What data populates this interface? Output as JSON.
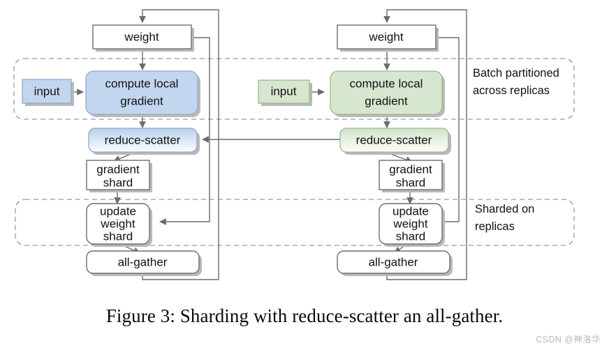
{
  "figure": {
    "caption": "Figure 3:  Sharding with reduce-scatter an all-gather.",
    "watermark": "CSDN @神洛华"
  },
  "colors": {
    "blue_fill": "#c3d6ef",
    "blue_stroke": "#8ea9c9",
    "blue_gradient_top": "#bcd2ec",
    "blue_gradient_bottom": "#fbfdff",
    "green_fill": "#d7e6cf",
    "green_stroke": "#9cb893",
    "green_gradient_top": "#d4e4cc",
    "green_gradient_bottom": "#fbfdfa",
    "plain_fill": "#ffffff",
    "edge_stroke": "#6b6b6b",
    "dashed_stroke": "#9a9a9a",
    "watermark_color": "#b9b9b9"
  },
  "regions": [
    {
      "name": "batch-partitioned-region",
      "label_line1": "Batch partitioned",
      "label_line2": "across replicas"
    },
    {
      "name": "sharded-region",
      "label_line1": "Sharded on",
      "label_line2": "replicas"
    }
  ],
  "columns": [
    {
      "name": "left-replica",
      "theme": "blue",
      "nodes": {
        "weight": "weight",
        "input": "input",
        "compute_local_gradient_line1": "compute local",
        "compute_local_gradient_line2": "gradient",
        "reduce_scatter": "reduce-scatter",
        "gradient_shard_line1": "gradient",
        "gradient_shard_line2": "shard",
        "update_weight_shard_line1": "update",
        "update_weight_shard_line2": "weight",
        "update_weight_shard_line3": "shard",
        "all_gather": "all-gather"
      }
    },
    {
      "name": "right-replica",
      "theme": "green",
      "nodes": {
        "weight": "weight",
        "input": "input",
        "compute_local_gradient_line1": "compute local",
        "compute_local_gradient_line2": "gradient",
        "reduce_scatter": "reduce-scatter",
        "gradient_shard_line1": "gradient",
        "gradient_shard_line2": "shard",
        "update_weight_shard_line1": "update",
        "update_weight_shard_line2": "weight",
        "update_weight_shard_line3": "shard",
        "all_gather": "all-gather"
      }
    }
  ]
}
